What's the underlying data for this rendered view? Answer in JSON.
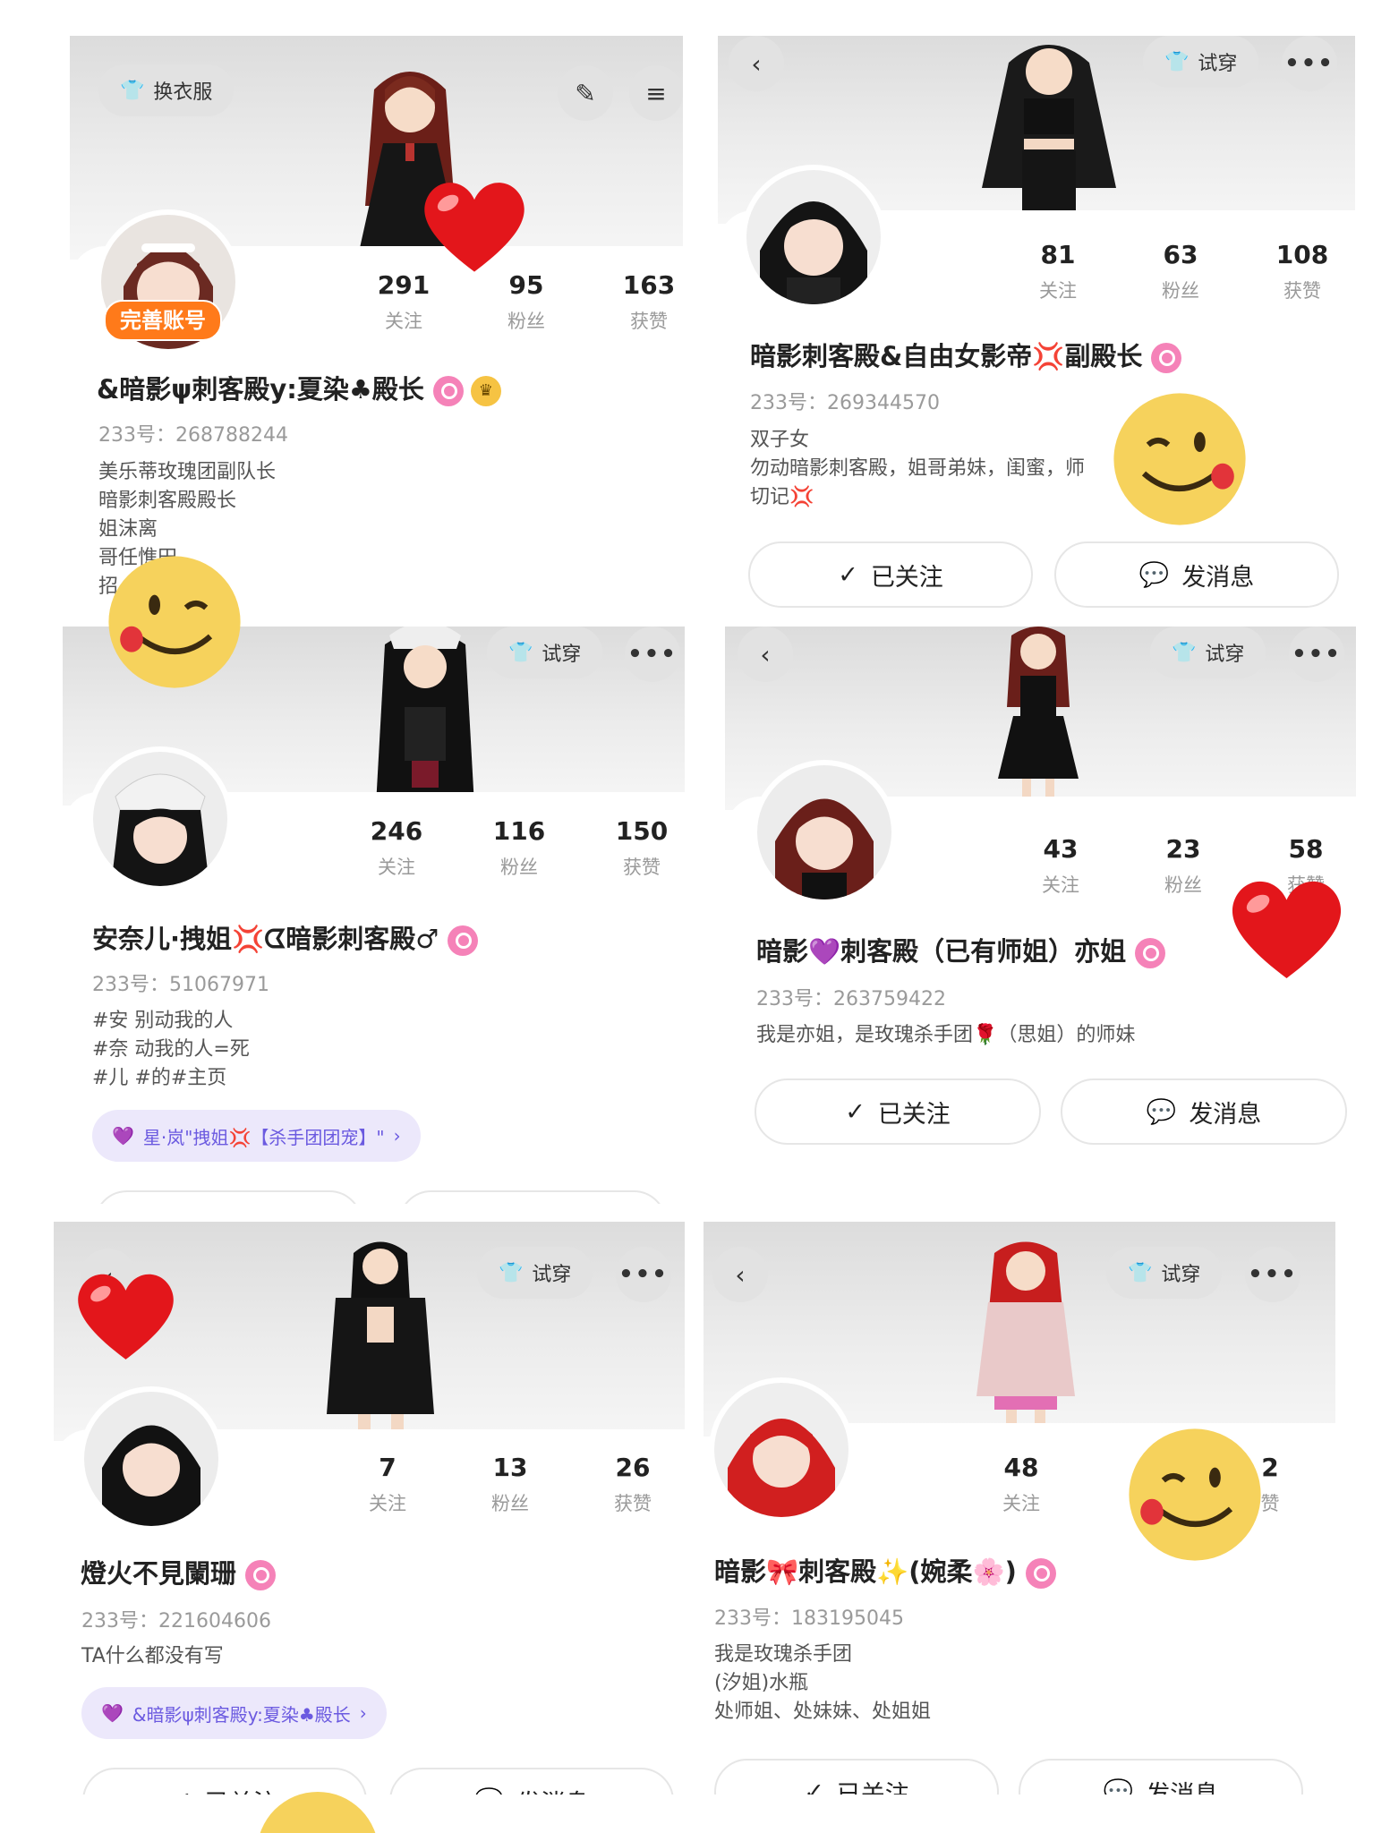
{
  "colors": {
    "accent_pink": "#f582b8",
    "accent_purple": "#6b5ae0",
    "orange_badge": "#ff7a1a"
  },
  "cards": [
    {
      "top_left_button": "换衣服",
      "avatar_badge": "完善账号",
      "stats": [
        {
          "num": "291",
          "label": "关注"
        },
        {
          "num": "95",
          "label": "粉丝"
        },
        {
          "num": "163",
          "label": "获赞"
        }
      ],
      "name": "&暗影ψ刺客殿y:夏染♣殿长",
      "uid": "233号：268788244",
      "bio": [
        "美乐蒂玫瑰团副队长",
        "暗影刺客殿殿长",
        "姐沫离",
        "哥任憔田",
        "招"
      ]
    },
    {
      "try_button": "试穿",
      "stats": [
        {
          "num": "81",
          "label": "关注"
        },
        {
          "num": "63",
          "label": "粉丝"
        },
        {
          "num": "108",
          "label": "获赞"
        }
      ],
      "name": "暗影刺客殿&自由女影帝💢副殿长",
      "uid": "233号：269344570",
      "bio": [
        "双子女",
        "勿动暗影刺客殿，姐哥弟妹，闺蜜，师",
        "切记💢"
      ],
      "follow_label": "已关注",
      "message_label": "发消息"
    },
    {
      "try_button": "试穿",
      "stats": [
        {
          "num": "246",
          "label": "关注"
        },
        {
          "num": "116",
          "label": "粉丝"
        },
        {
          "num": "150",
          "label": "获赞"
        }
      ],
      "name": "安奈儿·拽姐💢ᗧ暗影刺客殿♂",
      "uid": "233号：51067971",
      "bio": [
        "#安 别动我的人",
        "#奈 动我的人=死",
        "#儿 #的#主页"
      ],
      "tag": "星·岚\"拽姐💢【杀手团团宠】\""
    },
    {
      "try_button": "试穿",
      "stats": [
        {
          "num": "43",
          "label": "关注"
        },
        {
          "num": "23",
          "label": "粉丝"
        },
        {
          "num": "58",
          "label": "获赞"
        }
      ],
      "name": "暗影💜刺客殿（已有师姐）亦姐",
      "uid": "233号：263759422",
      "bio": [
        "我是亦姐，是玫瑰杀手团🌹（思姐）的师妹"
      ],
      "follow_label": "已关注",
      "message_label": "发消息"
    },
    {
      "try_button": "试穿",
      "stats": [
        {
          "num": "7",
          "label": "关注"
        },
        {
          "num": "13",
          "label": "粉丝"
        },
        {
          "num": "26",
          "label": "获赞"
        }
      ],
      "name": "燈火不見闌珊",
      "uid": "233号：221604606",
      "bio": [
        "TA什么都没有写"
      ],
      "tag": "&暗影ψ刺客殿y:夏染♣殿长",
      "follow_label": "已关注",
      "message_label": "发消息"
    },
    {
      "try_button": "试穿",
      "stats": [
        {
          "num": "48",
          "label": "关注"
        },
        {
          "num": "2",
          "label": "获赞"
        }
      ],
      "fans_fragment": "粉",
      "likes_fragment": "赞",
      "name": "暗影🎀刺客殿✨(婉柔🌸)",
      "uid": "233号：183195045",
      "bio": [
        "我是玫瑰杀手团",
        "(汐姐)水瓶",
        "处师姐、处妹妹、处姐姐"
      ],
      "follow_label": "已关注",
      "message_label": "发消息"
    }
  ]
}
